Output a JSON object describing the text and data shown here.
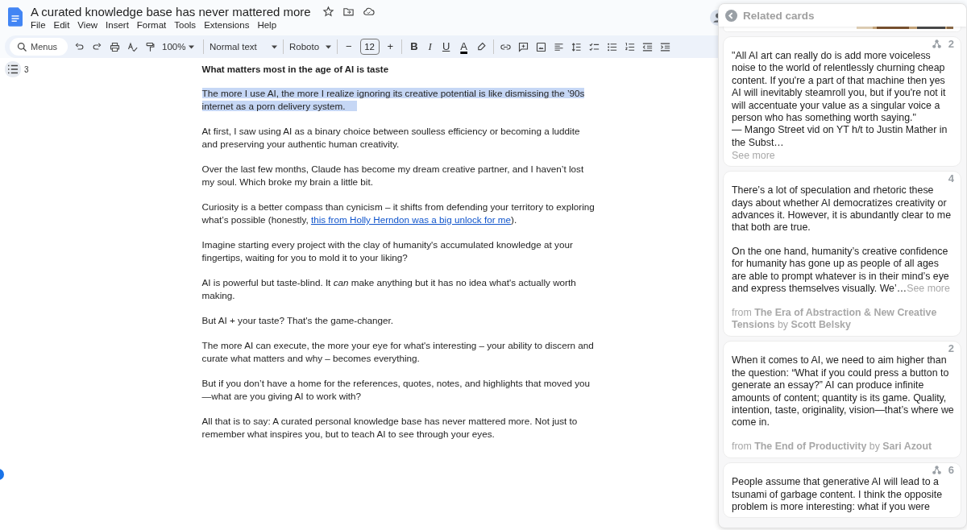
{
  "document": {
    "title": "A curated knowledge base has never mattered more",
    "menus": [
      "File",
      "Edit",
      "View",
      "Insert",
      "Format",
      "Tools",
      "Extensions",
      "Help"
    ],
    "toolbar": {
      "search_placeholder": "Menus",
      "zoom": "100%",
      "style": "Normal text",
      "font": "Roboto",
      "size": "12",
      "minus": "−",
      "plus": "+",
      "format": [
        "B",
        "I",
        "U",
        "A"
      ]
    },
    "outline_count": "3",
    "paragraphs": [
      {
        "kind": "heading",
        "selected": false,
        "segments": [
          {
            "kind": "text",
            "text": "What matters most in the age of AI is taste"
          }
        ]
      },
      {
        "kind": "body",
        "selected": true,
        "segments": [
          {
            "kind": "text",
            "text": "The more I use AI, the more I realize ignoring its creative potential is like dismissing the ’90s internet as a porn delivery system."
          }
        ]
      },
      {
        "kind": "body",
        "selected": false,
        "segments": [
          {
            "kind": "text",
            "text": "At first, I saw using AI as a binary choice between soulless efficiency or becoming a luddite and preserving your authentic human creativity."
          }
        ]
      },
      {
        "kind": "body",
        "selected": false,
        "segments": [
          {
            "kind": "text",
            "text": "Over the last few months, Claude has become my dream creative partner, and I haven’t lost my soul. Which broke my brain a little bit."
          }
        ]
      },
      {
        "kind": "body",
        "selected": false,
        "segments": [
          {
            "kind": "text",
            "text": "Curiosity is a better compass than cynicism – it shifts from defending your territory to exploring what’s possible (honestly, "
          },
          {
            "kind": "link",
            "text": "this from Holly Herndon was a big unlock for me"
          },
          {
            "kind": "text",
            "text": ")."
          }
        ]
      },
      {
        "kind": "body",
        "selected": false,
        "segments": [
          {
            "kind": "text",
            "text": "Imagine starting every project with the clay of humanity's accumulated knowledge at your fingertips, waiting for you to mold it to your liking?"
          }
        ]
      },
      {
        "kind": "body",
        "selected": false,
        "segments": [
          {
            "kind": "text",
            "text": "AI is powerful but taste-blind. It *can* make anything but it has no idea what's actually worth making."
          }
        ]
      },
      {
        "kind": "body",
        "selected": false,
        "segments": [
          {
            "kind": "text",
            "text": "But AI + your taste? That's the game-changer."
          }
        ]
      },
      {
        "kind": "body",
        "selected": false,
        "segments": [
          {
            "kind": "text",
            "text": "The more AI can execute, the more your eye for what's interesting – your ability to discern and curate what matters and why – becomes everything."
          }
        ]
      },
      {
        "kind": "body",
        "selected": false,
        "segments": [
          {
            "kind": "text",
            "text": "But if you don’t have a home for the references, quotes, notes, and highlights that moved you—what are you giving AI to work with?"
          }
        ]
      },
      {
        "kind": "body",
        "selected": false,
        "segments": [
          {
            "kind": "text",
            "text": "All that is to say: A curated personal knowledge base has never mattered more. Not just to remember what inspires you, but to teach AI to see through your eyes."
          }
        ]
      }
    ]
  },
  "related_panel": {
    "title": "Related cards",
    "cards": [
      {
        "kind": "picture"
      },
      {
        "kind": "quote",
        "shared": true,
        "count": "2",
        "paragraphs": [
          "\"All AI art can really do is add more voiceless noise to the world of relentlessly churning cheap content. If you're a part of that machine then yes AI will inevitably steamroll you, but if you're not it will accentuate your value as a singular voice a person who has something worth saying.\"\n— Mango Street vid on YT h/t to Justin Mather in the Subst…"
        ],
        "see_more": "See more",
        "see_more_inline": false
      },
      {
        "kind": "quote",
        "shared": false,
        "count": "4",
        "paragraphs": [
          "There’s a lot of speculation and rhetoric these days about whether AI democratizes creativity or advances it. However, it is abundantly clear to me that both are true.",
          "On the one hand, humanity’s creative confidence for humanity has gone up as people of all ages are able to prompt whatever is in their mind’s eye and express themselves visually. We’…"
        ],
        "see_more": "See more",
        "see_more_inline": true,
        "source": "from **The Era of Abstraction & New Creative Tensions** by **Scott Belsky**"
      },
      {
        "kind": "quote",
        "shared": false,
        "count": "2",
        "paragraphs": [
          "When it comes to AI, we need to aim higher than the question: “What if you could press a button to generate an essay?” AI can produce infinite amounts of content; quantity is its game. Quality, intention, taste, originality, vision—that’s where we come in."
        ],
        "source": "from **The End of Productivity** by **Sari Azout**"
      },
      {
        "kind": "quote",
        "shared": true,
        "count": "6",
        "paragraphs": [
          "People assume that generative AI will lead to a tsunami of garbage content. I think the opposite problem is more interesting: what if you were"
        ]
      }
    ]
  }
}
